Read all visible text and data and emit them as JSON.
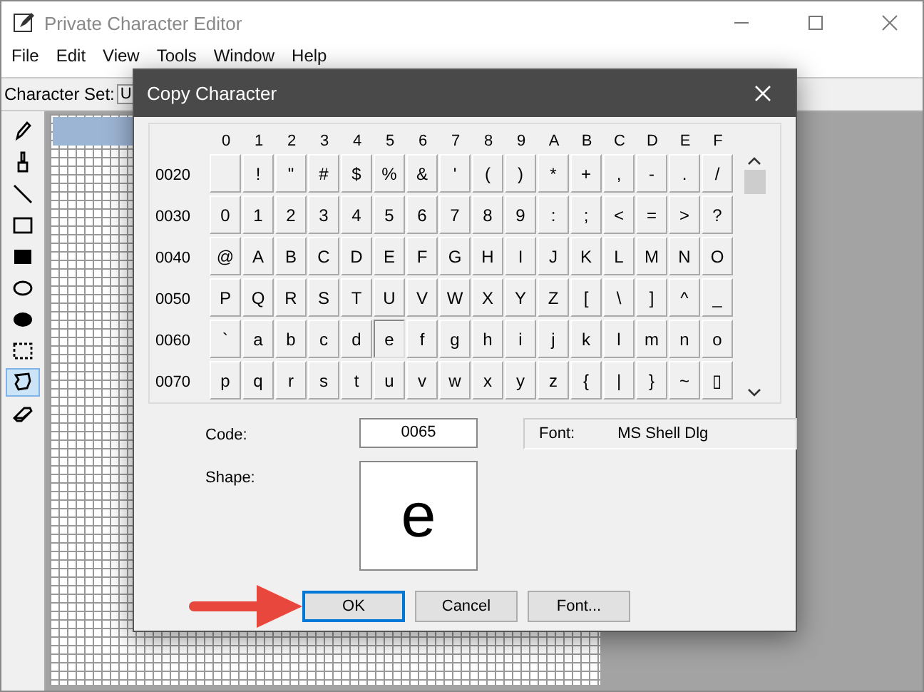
{
  "window": {
    "title": "Private Character Editor"
  },
  "menu": [
    "File",
    "Edit",
    "View",
    "Tools",
    "Window",
    "Help"
  ],
  "character_set": {
    "label": "Character Set:",
    "value": "U"
  },
  "tools": [
    {
      "kind": "pencil",
      "selected": false
    },
    {
      "kind": "brush",
      "selected": false
    },
    {
      "kind": "line",
      "selected": false
    },
    {
      "kind": "rect",
      "selected": false
    },
    {
      "kind": "filled-rect",
      "selected": false
    },
    {
      "kind": "ellipse",
      "selected": false
    },
    {
      "kind": "filled-ellipse",
      "selected": false
    },
    {
      "kind": "rect-select",
      "selected": false
    },
    {
      "kind": "freeform-select",
      "selected": true
    },
    {
      "kind": "eraser",
      "selected": false
    }
  ],
  "dialog": {
    "title": "Copy Character",
    "columns": [
      "0",
      "1",
      "2",
      "3",
      "4",
      "5",
      "6",
      "7",
      "8",
      "9",
      "A",
      "B",
      "C",
      "D",
      "E",
      "F"
    ],
    "rows": [
      {
        "code": "0020",
        "cells": [
          {
            "selected": false
          },
          {
            "char": "!",
            "selected": false
          },
          {
            "char": "\"",
            "selected": false
          },
          {
            "char": "#",
            "selected": false
          },
          {
            "char": "$",
            "selected": false
          },
          {
            "char": "%",
            "selected": false
          },
          {
            "char": "&",
            "selected": false
          },
          {
            "char": "'",
            "selected": false
          },
          {
            "char": "(",
            "selected": false
          },
          {
            "char": ")",
            "selected": false
          },
          {
            "char": "*",
            "selected": false
          },
          {
            "char": "+",
            "selected": false
          },
          {
            "char": ",",
            "selected": false
          },
          {
            "char": "-",
            "selected": false
          },
          {
            "char": ".",
            "selected": false
          },
          {
            "char": "/",
            "selected": false
          }
        ]
      },
      {
        "code": "0030",
        "cells": [
          {
            "char": "0",
            "selected": false
          },
          {
            "char": "1",
            "selected": false
          },
          {
            "char": "2",
            "selected": false
          },
          {
            "char": "3",
            "selected": false
          },
          {
            "char": "4",
            "selected": false
          },
          {
            "char": "5",
            "selected": false
          },
          {
            "char": "6",
            "selected": false
          },
          {
            "char": "7",
            "selected": false
          },
          {
            "char": "8",
            "selected": false
          },
          {
            "char": "9",
            "selected": false
          },
          {
            "char": ":",
            "selected": false
          },
          {
            "char": ";",
            "selected": false
          },
          {
            "char": "<",
            "selected": false
          },
          {
            "char": "=",
            "selected": false
          },
          {
            "char": ">",
            "selected": false
          },
          {
            "char": "?",
            "selected": false
          }
        ]
      },
      {
        "code": "0040",
        "cells": [
          {
            "char": "@",
            "selected": false
          },
          {
            "char": "A",
            "selected": false
          },
          {
            "char": "B",
            "selected": false
          },
          {
            "char": "C",
            "selected": false
          },
          {
            "char": "D",
            "selected": false
          },
          {
            "char": "E",
            "selected": false
          },
          {
            "char": "F",
            "selected": false
          },
          {
            "char": "G",
            "selected": false
          },
          {
            "char": "H",
            "selected": false
          },
          {
            "char": "I",
            "selected": false
          },
          {
            "char": "J",
            "selected": false
          },
          {
            "char": "K",
            "selected": false
          },
          {
            "char": "L",
            "selected": false
          },
          {
            "char": "M",
            "selected": false
          },
          {
            "char": "N",
            "selected": false
          },
          {
            "char": "O",
            "selected": false
          }
        ]
      },
      {
        "code": "0050",
        "cells": [
          {
            "char": "P",
            "selected": false
          },
          {
            "char": "Q",
            "selected": false
          },
          {
            "char": "R",
            "selected": false
          },
          {
            "char": "S",
            "selected": false
          },
          {
            "char": "T",
            "selected": false
          },
          {
            "char": "U",
            "selected": false
          },
          {
            "char": "V",
            "selected": false
          },
          {
            "char": "W",
            "selected": false
          },
          {
            "char": "X",
            "selected": false
          },
          {
            "char": "Y",
            "selected": false
          },
          {
            "char": "Z",
            "selected": false
          },
          {
            "char": "[",
            "selected": false
          },
          {
            "char": "\\",
            "selected": false
          },
          {
            "char": "]",
            "selected": false
          },
          {
            "char": "^",
            "selected": false
          },
          {
            "char": "_",
            "selected": false
          }
        ]
      },
      {
        "code": "0060",
        "cells": [
          {
            "char": "`",
            "selected": false
          },
          {
            "char": "a",
            "selected": false
          },
          {
            "char": "b",
            "selected": false
          },
          {
            "char": "c",
            "selected": false
          },
          {
            "char": "d",
            "selected": false
          },
          {
            "char": "e",
            "selected": true
          },
          {
            "char": "f",
            "selected": false
          },
          {
            "char": "g",
            "selected": false
          },
          {
            "char": "h",
            "selected": false
          },
          {
            "char": "i",
            "selected": false
          },
          {
            "char": "j",
            "selected": false
          },
          {
            "char": "k",
            "selected": false
          },
          {
            "char": "l",
            "selected": false
          },
          {
            "char": "m",
            "selected": false
          },
          {
            "char": "n",
            "selected": false
          },
          {
            "char": "o",
            "selected": false
          }
        ]
      },
      {
        "code": "0070",
        "cells": [
          {
            "char": "p",
            "selected": false
          },
          {
            "char": "q",
            "selected": false
          },
          {
            "char": "r",
            "selected": false
          },
          {
            "char": "s",
            "selected": false
          },
          {
            "char": "t",
            "selected": false
          },
          {
            "char": "u",
            "selected": false
          },
          {
            "char": "v",
            "selected": false
          },
          {
            "char": "w",
            "selected": false
          },
          {
            "char": "x",
            "selected": false
          },
          {
            "char": "y",
            "selected": false
          },
          {
            "char": "z",
            "selected": false
          },
          {
            "char": "{",
            "selected": false
          },
          {
            "char": "|",
            "selected": false
          },
          {
            "char": "}",
            "selected": false
          },
          {
            "char": "~",
            "selected": false
          },
          {
            "char": "▯",
            "selected": false
          }
        ]
      }
    ],
    "code": {
      "label": "Code:",
      "value": "0065"
    },
    "font": {
      "label": "Font:",
      "value": "MS Shell Dlg"
    },
    "shape": {
      "label": "Shape:",
      "glyph": "e"
    },
    "buttons": [
      {
        "label": "OK",
        "default": true
      },
      {
        "label": "Cancel",
        "default": false
      },
      {
        "label": "Font...",
        "default": false
      }
    ]
  }
}
